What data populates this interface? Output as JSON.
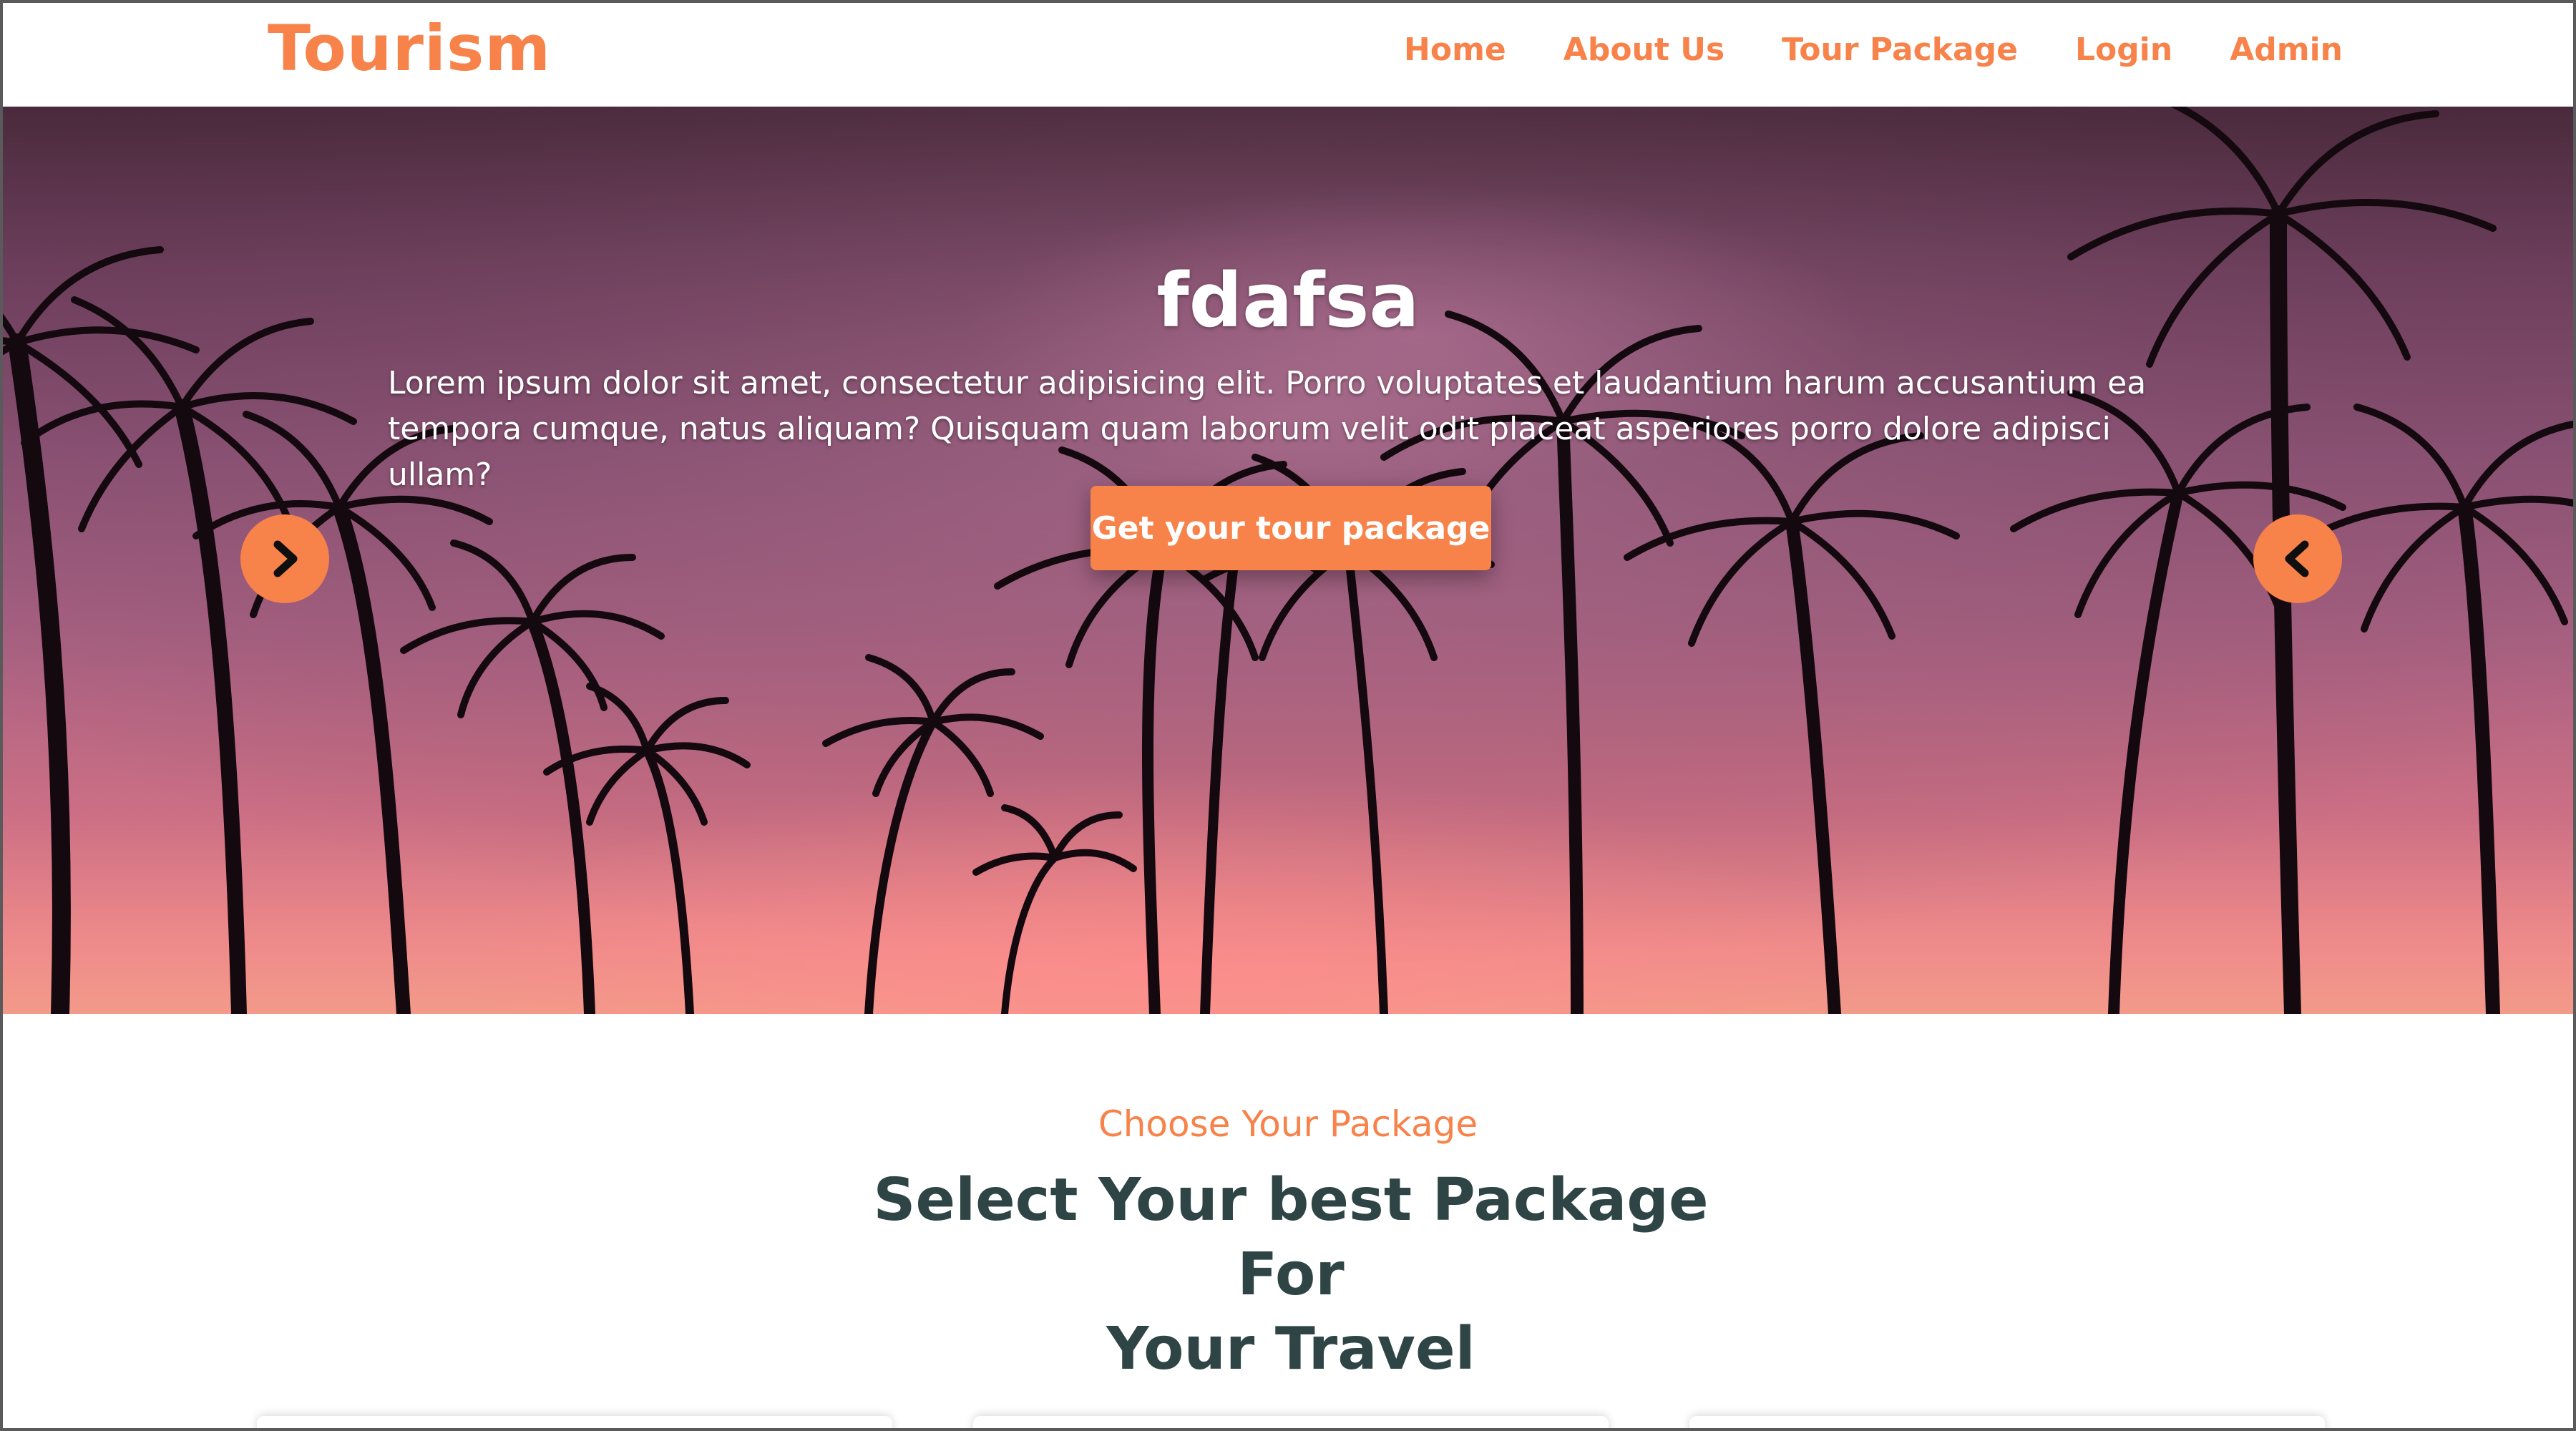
{
  "navbar": {
    "brand": "Tourism",
    "links": [
      {
        "label": "Home"
      },
      {
        "label": "About Us"
      },
      {
        "label": "Tour Package"
      },
      {
        "label": "Login"
      },
      {
        "label": "Admin"
      }
    ]
  },
  "hero": {
    "title": "fdafsa",
    "text_line1": "Lorem ipsum dolor sit amet, consectetur adipisicing elit. Porro voluptates et laudantium harum accusantium ea",
    "text_line2": "tempora cumque, natus aliquam? Quisquam quam laborum velit odit placeat asperiores porro dolore adipisci ullam?",
    "cta_label": "Get your tour package",
    "next_icon": "chevron-right-icon",
    "prev_icon": "chevron-left-icon"
  },
  "packages": {
    "subtitle": "Choose Your Package",
    "title_line1": "Select Your best Package For",
    "title_line2": "Your Travel"
  },
  "colors": {
    "accent": "#f7824a",
    "heading": "#2f4545",
    "background": "#ffffff"
  }
}
